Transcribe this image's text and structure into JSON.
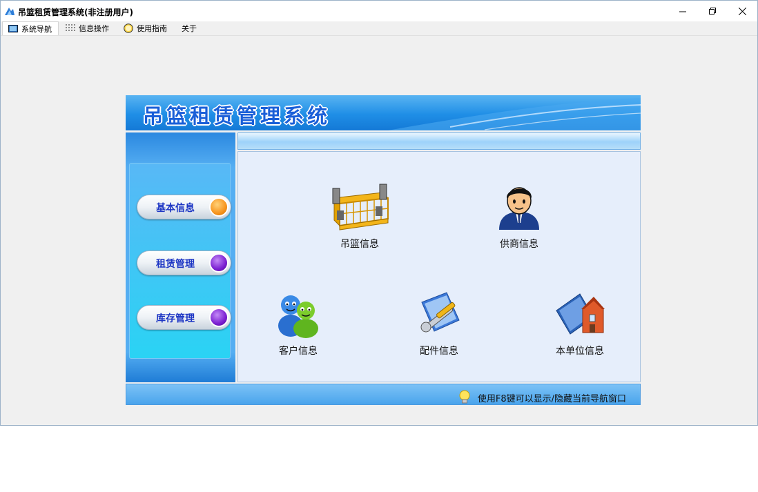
{
  "window": {
    "title": "吊篮租赁管理系统(非注册用户)",
    "controls": [
      "minimize",
      "restore",
      "close"
    ]
  },
  "menu": {
    "tabs": [
      {
        "label": "系统导航",
        "icon": "monitor-icon"
      },
      {
        "label": "信息操作",
        "icon": "grid-icon"
      },
      {
        "label": "使用指南",
        "icon": "clock-icon"
      },
      {
        "label": "关于"
      }
    ]
  },
  "main": {
    "banner_title": "吊篮租赁管理系统",
    "sidebar": {
      "buttons": [
        {
          "label": "基本信息",
          "dot_color": "#f7941d"
        },
        {
          "label": "租赁管理",
          "dot_color": "#7a1fd1"
        },
        {
          "label": "库存管理",
          "dot_color": "#7a1fd1"
        }
      ]
    },
    "items": [
      {
        "label": "吊篮信息",
        "icon": "gondola-icon"
      },
      {
        "label": "供商信息",
        "icon": "supplier-person-icon"
      },
      {
        "label": "客户信息",
        "icon": "customers-icon"
      },
      {
        "label": "配件信息",
        "icon": "tools-icon"
      },
      {
        "label": "本单位信息",
        "icon": "building-icon"
      }
    ],
    "footer_hint": "使用F8键可以显示/隐藏当前导航窗口"
  }
}
